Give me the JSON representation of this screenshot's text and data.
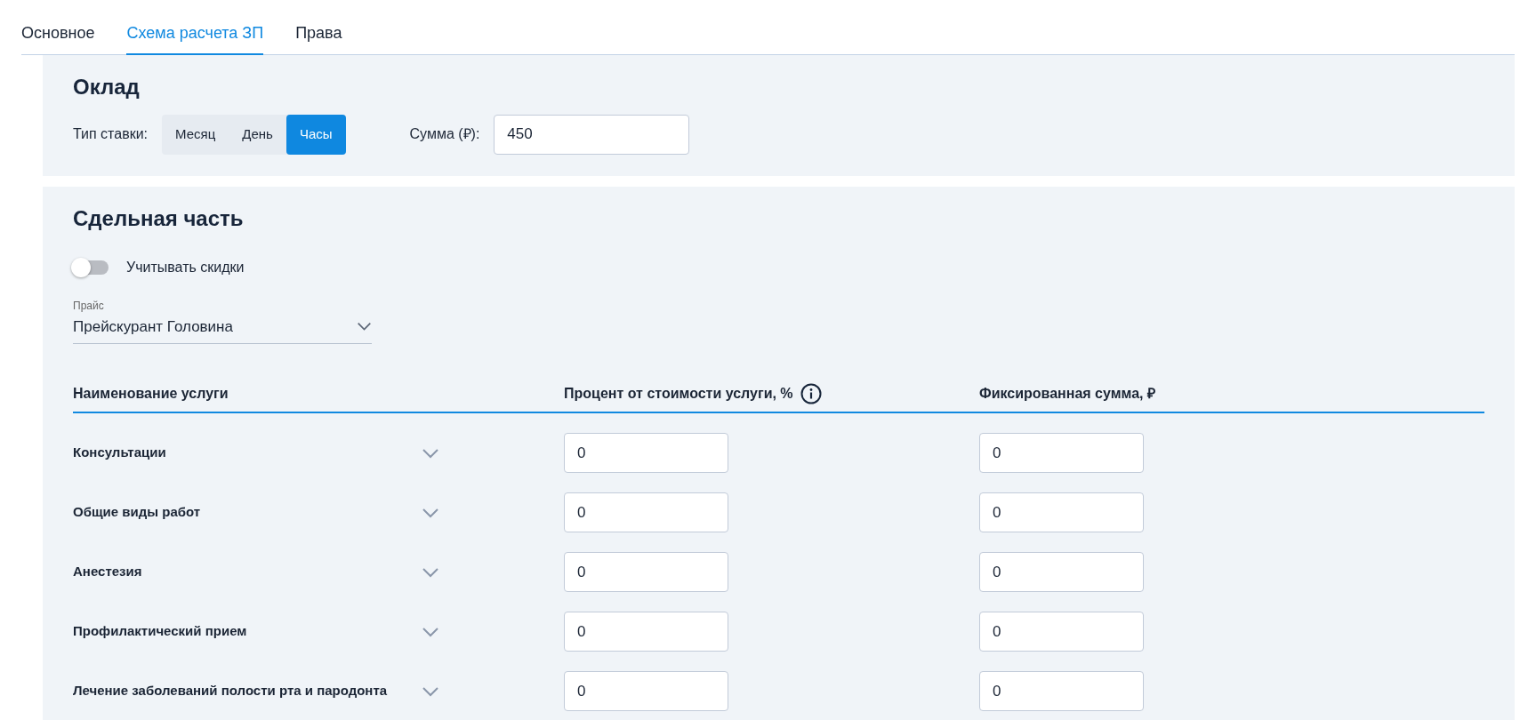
{
  "tabs": [
    {
      "label": "Основное",
      "selected": false
    },
    {
      "label": "Схема расчета ЗП",
      "selected": true
    },
    {
      "label": "Права",
      "selected": false
    }
  ],
  "salary": {
    "title": "Оклад",
    "rate_label": "Тип ставки:",
    "rate_types": [
      {
        "label": "Месяц",
        "selected": false
      },
      {
        "label": "День",
        "selected": false
      },
      {
        "label": "Часы",
        "selected": true
      }
    ],
    "amount_label": "Сумма (₽):",
    "amount_value": "450"
  },
  "piecework": {
    "title": "Сдельная часть",
    "discount_toggle": {
      "label": "Учитывать скидки",
      "on": false
    },
    "price_list": {
      "label": "Прайс",
      "value": "Прейскурант Головина"
    },
    "table": {
      "columns": [
        "Наименование услуги",
        "Процент от стоимости услуги, %",
        "Фиксированная сумма, ₽"
      ],
      "rows": [
        {
          "name": "Консультации",
          "expanded": false,
          "percent": "0",
          "fixed": "0"
        },
        {
          "name": "Общие виды работ",
          "expanded": false,
          "percent": "0",
          "fixed": "0"
        },
        {
          "name": "Анестезия",
          "expanded": false,
          "percent": "0",
          "fixed": "0"
        },
        {
          "name": "Профилактический прием",
          "expanded": false,
          "percent": "0",
          "fixed": "0"
        },
        {
          "name": "Лечение заболеваний полости рта и пародонта",
          "expanded": false,
          "percent": "0",
          "fixed": "0"
        }
      ]
    }
  }
}
